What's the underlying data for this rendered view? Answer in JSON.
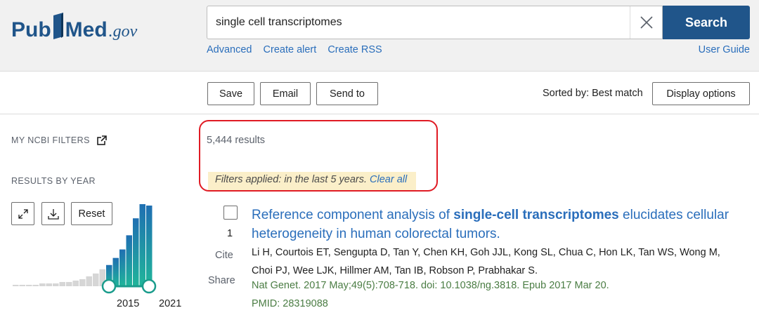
{
  "header": {
    "logo_pub": "Pub",
    "logo_med": "Med",
    "logo_gov": ".gov",
    "search_value": "single cell transcriptomes",
    "search_button": "Search",
    "links": {
      "advanced": "Advanced",
      "create_alert": "Create alert",
      "create_rss": "Create RSS",
      "user_guide": "User Guide"
    }
  },
  "toolbar": {
    "save": "Save",
    "email": "Email",
    "send_to": "Send to",
    "sorted_by": "Sorted by: Best match",
    "display_options": "Display options"
  },
  "sidebar": {
    "my_ncbi_filters": "MY NCBI FILTERS",
    "results_by_year": "RESULTS BY YEAR",
    "reset": "Reset",
    "year_start": "2015",
    "year_end": "2021"
  },
  "results": {
    "count": "5,444 results",
    "filters_applied": "Filters applied: in the last 5 years.",
    "clear_all": "Clear all"
  },
  "article": {
    "number": "1",
    "cite": "Cite",
    "share": "Share",
    "title_before": "Reference component analysis of ",
    "title_bold": "single-cell transcriptomes",
    "title_after": " elucidates cellular heterogeneity in human colorectal tumors.",
    "authors": "Li H, Courtois ET, Sengupta D, Tan Y, Chen KH, Goh JJL, Kong SL, Chua C, Hon LK, Tan WS, Wong M, Choi PJ, Wee LJK, Hillmer AM, Tan IB, Robson P, Prabhakar S.",
    "journal": "Nat Genet. 2017 May;49(5):708-718. doi: 10.1038/ng.3818. Epub 2017 Mar 20.",
    "pmid": "PMID: 28319088"
  },
  "colors": {
    "brand": "#20558a",
    "link": "#2a6ebb",
    "highlight": "#e01b24",
    "bar_gray": "#d6d6d6",
    "bar_selected": "#1a9c8c"
  },
  "chart_data": {
    "type": "bar",
    "selected_range": [
      "2015",
      "2021"
    ],
    "values": [
      1,
      1,
      1,
      1,
      2,
      2,
      2,
      3,
      3,
      4,
      5,
      7,
      9,
      12,
      15,
      20,
      26,
      36,
      48,
      58,
      57
    ],
    "selected_from_index": 14
  }
}
